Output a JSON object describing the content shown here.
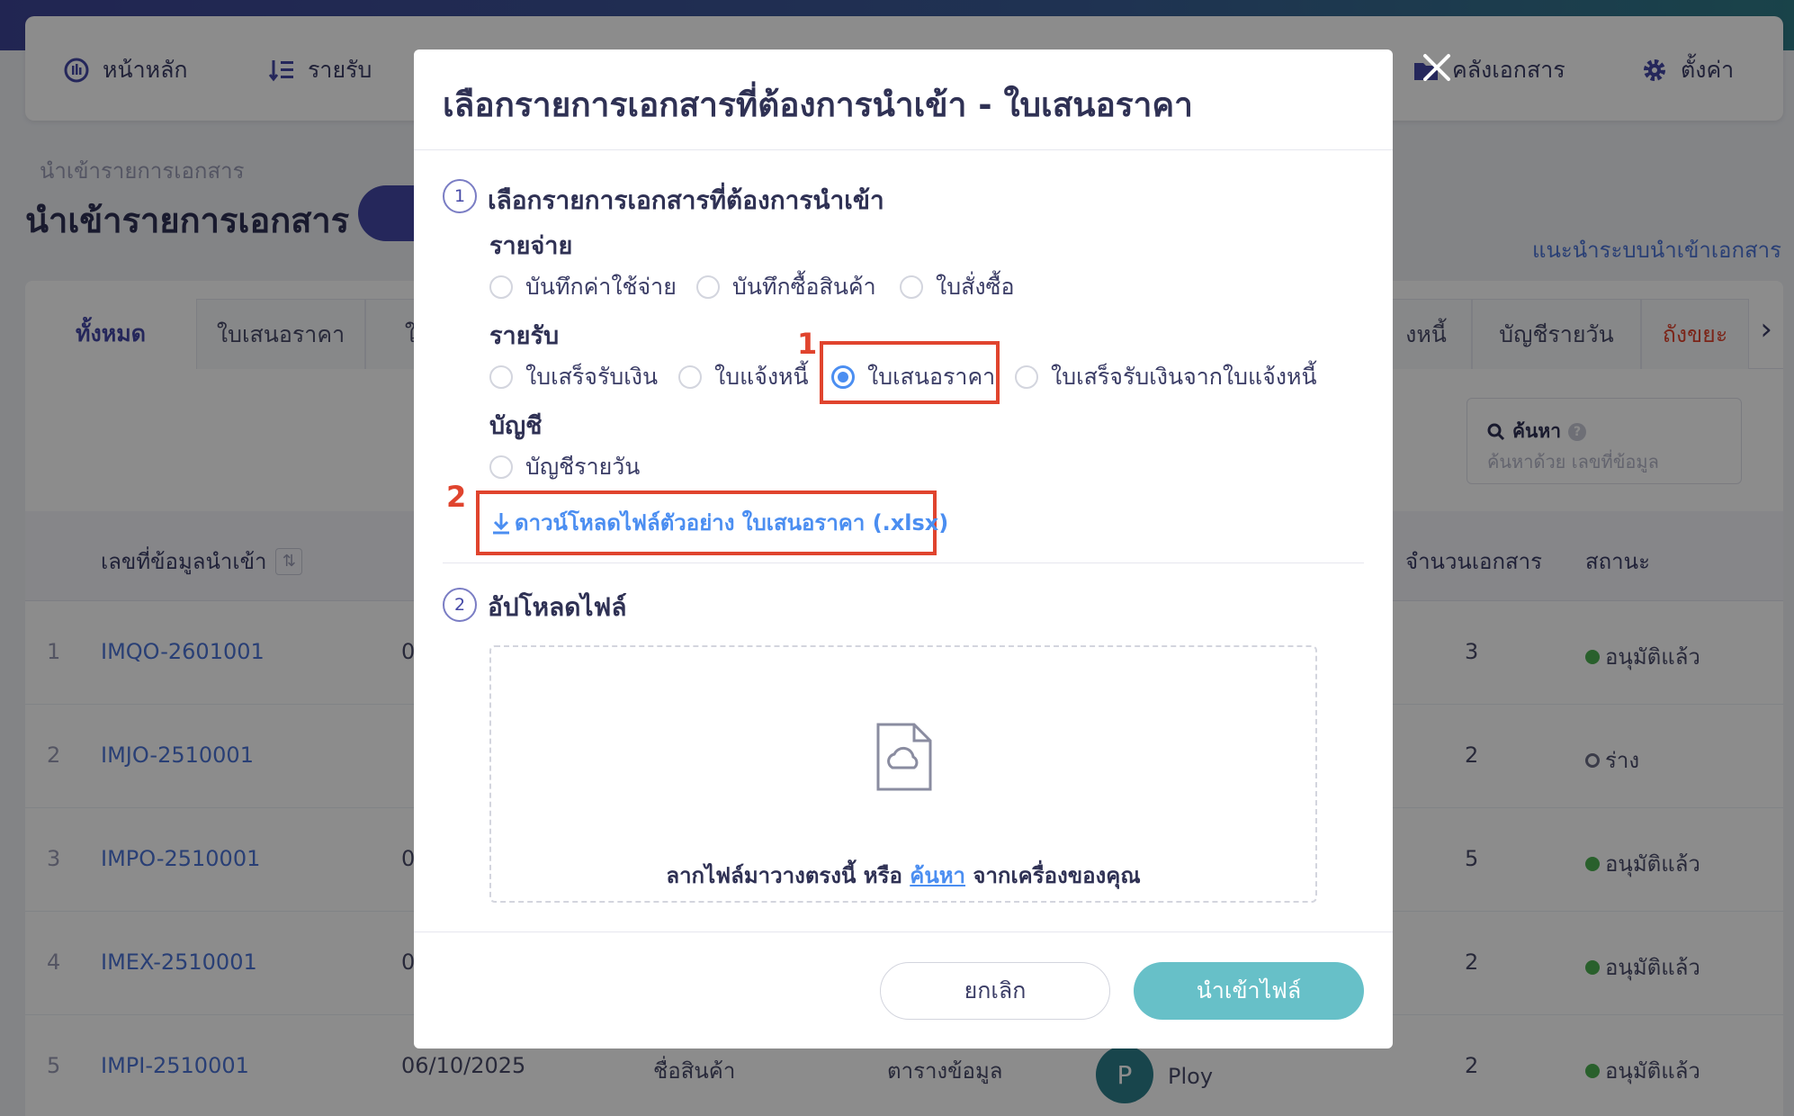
{
  "nav": {
    "home": "หน้าหลัก",
    "income": "รายรับ",
    "documents": "คลังเอกสาร",
    "settings": "ตั้งค่า"
  },
  "page": {
    "breadcrumb": "นำเข้ารายการเอกสาร",
    "title": "นำเข้ารายการเอกสาร",
    "guide_link": "แนะนำระบบนำเข้าเอกสาร"
  },
  "tabs": {
    "all": "ทั้งหมด",
    "quotation": "ใบเสนอราคา",
    "partial_left": "ใ",
    "partial_right": "งหนี้",
    "daily": "บัญชีรายวัน",
    "partial_red": "ถังขยะ"
  },
  "search": {
    "label": "ค้นหา",
    "placeholder": "ค้นหาด้วย เลขที่ข้อมูล"
  },
  "table": {
    "col_id": "เลขที่ข้อมูลนำเข้า",
    "col_count": "จำนวนเอกสาร",
    "col_status": "สถานะ",
    "rows": [
      {
        "num": "1",
        "code": "IMQO-2601001",
        "date": "0",
        "count": "3",
        "status": "อนุมัติแล้ว"
      },
      {
        "num": "2",
        "code": "IMJO-2510001",
        "date": "",
        "count": "2",
        "status": "ร่าง"
      },
      {
        "num": "3",
        "code": "IMPO-2510001",
        "date": "0",
        "count": "5",
        "status": "อนุมัติแล้ว"
      },
      {
        "num": "4",
        "code": "IMEX-2510001",
        "date": "0",
        "count": "2",
        "status": "อนุมัติแล้ว"
      },
      {
        "num": "5",
        "code": "IMPI-2510001",
        "date": "06/10/2025",
        "count": "2",
        "status": "อนุมัติแล้ว",
        "type": "ชื่อสินค้า",
        "source": "ตารางข้อมูล",
        "avatar": "P",
        "user": "Ploy"
      }
    ]
  },
  "modal": {
    "title": "เลือกรายการเอกสารที่ต้องการนำเข้า - ใบเสนอราคา",
    "step1_num": "1",
    "step1_title": "เลือกรายการเอกสารที่ต้องการนำเข้า",
    "group_expense": "รายจ่าย",
    "expense_options": [
      "บันทึกค่าใช้จ่าย",
      "บันทึกซื้อสินค้า",
      "ใบสั่งซื้อ"
    ],
    "group_income": "รายรับ",
    "income_options": [
      "ใบเสร็จรับเงิน",
      "ใบแจ้งหนี้",
      "ใบเสนอราคา",
      "ใบเสร็จรับเงินจากใบแจ้งหนี้"
    ],
    "selected_option": "ใบเสนอราคา",
    "group_account": "บัญชี",
    "account_options": [
      "บัญชีรายวัน"
    ],
    "annotation_1": "1",
    "annotation_2": "2",
    "download_link": "ดาวน์โหลดไฟล์ตัวอย่าง ใบเสนอราคา (.xlsx)",
    "step2_num": "2",
    "step2_title": "อัปโหลดไฟล์",
    "drop_text_before": "ลากไฟล์มาวางตรงนี้ หรือ ",
    "drop_link": "ค้นหา",
    "drop_text_after": " จากเครื่องของคุณ",
    "cancel_button": "ยกเลิก",
    "import_button": "นำเข้าไฟล์"
  },
  "colors": {
    "primary": "#4448a6",
    "link": "#4b8ef1",
    "annotation": "#e0442e",
    "import_button": "#67c0c8",
    "approved": "#4caf50"
  }
}
